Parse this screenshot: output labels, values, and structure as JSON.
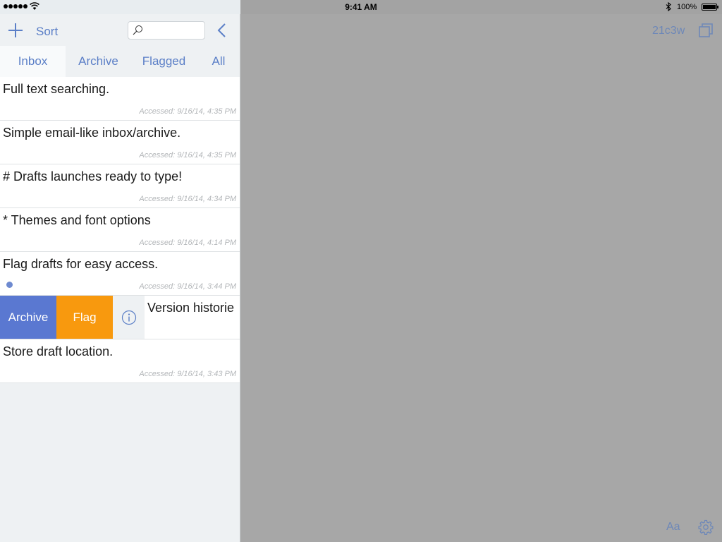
{
  "status": {
    "time": "9:41 AM",
    "battery": "100%"
  },
  "toolbar": {
    "sort_label": "Sort",
    "search_placeholder": ""
  },
  "tabs": [
    {
      "label": "Inbox",
      "active": true
    },
    {
      "label": "Archive",
      "active": false
    },
    {
      "label": "Flagged",
      "active": false
    },
    {
      "label": "All",
      "active": false
    }
  ],
  "drafts": [
    {
      "title": "Full text searching.",
      "meta": "Accessed: 9/16/14, 4:35 PM"
    },
    {
      "title": "Simple email-like inbox/archive.",
      "meta": "Accessed: 9/16/14, 4:35 PM"
    },
    {
      "title": "# Drafts launches ready to type!",
      "meta": "Accessed: 9/16/14, 4:34 PM"
    },
    {
      "title": "* Themes and font options",
      "meta": "Accessed: 9/16/14, 4:14 PM"
    },
    {
      "title": "Flag drafts for easy access.",
      "meta": "Accessed: 9/16/14, 3:44 PM",
      "flagged": true
    },
    {
      "title": "Version historie",
      "swipe_archive": "Archive",
      "swipe_flag": "Flag"
    },
    {
      "title": "Store draft location.",
      "meta": "Accessed: 9/16/14, 3:43 PM"
    }
  ],
  "editor": {
    "count": "21c3w",
    "font_label": "Aa"
  },
  "colors": {
    "accent": "#5b7fc7",
    "archive": "#5a78d1",
    "flag": "#f8990e",
    "flag_dot": "#6e8ad0"
  },
  "icons": [
    "plus-icon",
    "search-icon",
    "chevron-left-icon",
    "info-icon",
    "expand-icon",
    "gear-icon",
    "wifi-icon",
    "bluetooth-icon",
    "battery-icon"
  ]
}
